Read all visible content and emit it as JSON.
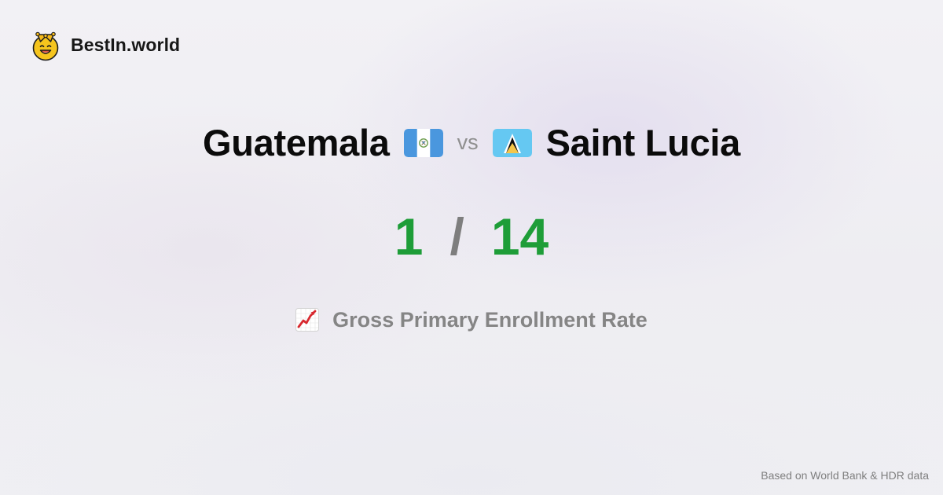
{
  "brand": {
    "name": "BestIn.world",
    "icon": "crown-smile-icon"
  },
  "comparison": {
    "left_country": "Guatemala",
    "left_flag": "guatemala-flag-icon",
    "separator": "vs",
    "right_country": "Saint Lucia",
    "right_flag": "saint-lucia-flag-icon"
  },
  "ranks": {
    "left": "1",
    "separator": "/",
    "right": "14"
  },
  "metric": {
    "icon": "chart-increasing-icon",
    "label": "Gross Primary Enrollment Rate"
  },
  "footer": {
    "source": "Based on World Bank & HDR data"
  },
  "colors": {
    "rank": "#1e9d38",
    "separator": "#7e7e7e",
    "metric_text": "#858585",
    "source_text": "#7f7f7f"
  }
}
